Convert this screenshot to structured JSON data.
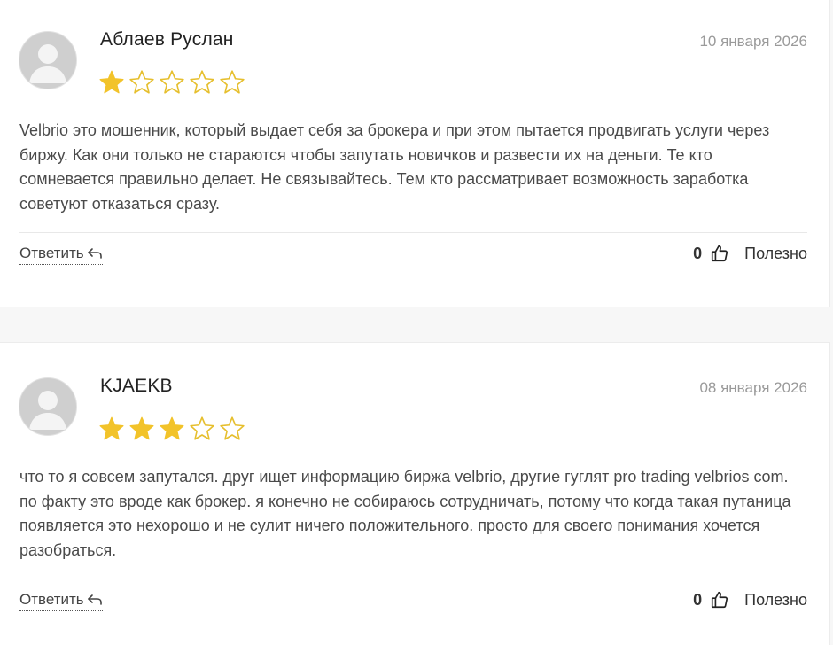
{
  "reviews": [
    {
      "author": "Аблаев Руслан",
      "date": "10 января 2026",
      "rating": 1,
      "max_rating": 5,
      "text": "Velbrio это мошенник, который выдает себя за брокера и при этом пытается продвигать услуги через биржу. Как они только не стараются чтобы запутать новичков и развести их на деньги. Те кто сомневается правильно делает. Не связывайтесь. Тем кто рассматривает возможность заработка советуют отказаться сразу.",
      "reply_label": "Ответить",
      "likes": "0",
      "useful_label": "Полезно"
    },
    {
      "author": "KJAEKB",
      "date": "08 января 2026",
      "rating": 3,
      "max_rating": 5,
      "text": "что то я совсем запутался. друг ищет информацию биржа velbrio, другие гуглят pro trading velbrios com. по факту это вроде как брокер. я конечно не собираюсь сотрудничать, потому что когда такая путаница появляется это нехорошо и не сулит ничего положительного. просто для своего понимания хочется разобраться.",
      "reply_label": "Ответить",
      "likes": "0",
      "useful_label": "Полезно"
    }
  ],
  "colors": {
    "star_filled": "#f2c32a",
    "star_empty_stroke": "#e6bf2e",
    "avatar_bg": "#cfcfcf",
    "avatar_figure": "#f4f4f4"
  },
  "icons": {
    "avatar": "user-silhouette-icon",
    "star": "star-icon",
    "reply": "reply-arrow-icon",
    "like": "thumbs-up-icon"
  }
}
